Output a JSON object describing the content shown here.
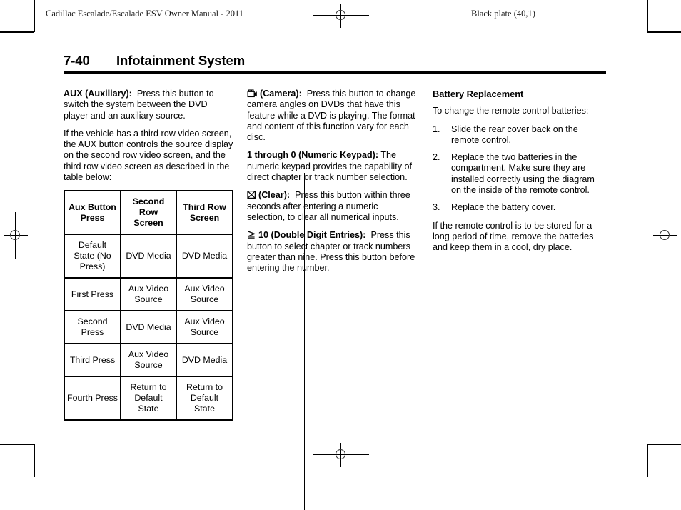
{
  "header": {
    "left": "Cadillac Escalade/Escalade ESV Owner Manual - 2011",
    "right": "Black plate (40,1)"
  },
  "title": {
    "number": "7-40",
    "text": "Infotainment System"
  },
  "column1": {
    "aux_lead": "AUX (Auxiliary):",
    "aux_body": "Press this button to switch the system between the DVD player and an auxiliary source.",
    "para2": "If the vehicle has a third row video screen, the AUX button controls the source display on the second row video screen, and the third row video screen as described in the table below:",
    "table": {
      "headers": [
        "Aux Button Press",
        "Second Row Screen",
        "Third Row Screen"
      ],
      "rows": [
        [
          "Default State (No Press)",
          "DVD Media",
          "DVD Media"
        ],
        [
          "First Press",
          "Aux Video Source",
          "Aux Video Source"
        ],
        [
          "Second Press",
          "DVD Media",
          "Aux Video Source"
        ],
        [
          "Third Press",
          "Aux Video Source",
          "DVD Media"
        ],
        [
          "Fourth Press",
          "Return to Default State",
          "Return to Default State"
        ]
      ]
    }
  },
  "column2": {
    "camera_icon": "camcorder-icon",
    "camera_lead": "(Camera):",
    "camera_body": "Press this button to change camera angles on DVDs that have this feature while a DVD is playing. The format and content of this function vary for each disc.",
    "keypad_lead": "1 through 0 (Numeric Keypad):",
    "keypad_body": "The numeric keypad provides the capability of direct chapter or track number selection.",
    "clear_icon": "crossed-box-clear-icon",
    "clear_lead": "(Clear):",
    "clear_body": "Press this button within three seconds after entering a numeric selection, to clear all numerical inputs.",
    "double_icon": "greater-than-or-equal-icon",
    "double_lead": "10 (Double Digit Entries):",
    "double_body": "Press this button to select chapter or track numbers greater than nine. Press this button before entering the number."
  },
  "column3": {
    "heading": "Battery Replacement",
    "intro": "To change the remote control batteries:",
    "steps": [
      {
        "num": "1.",
        "text": "Slide the rear cover back on the remote control."
      },
      {
        "num": "2.",
        "text": "Replace the two batteries in the compartment. Make sure they are installed correctly using the diagram on the inside of the remote control."
      },
      {
        "num": "3.",
        "text": "Replace the battery cover."
      }
    ],
    "outro": "If the remote control is to be stored for a long period of time, remove the batteries and keep them in a cool, dry place."
  }
}
